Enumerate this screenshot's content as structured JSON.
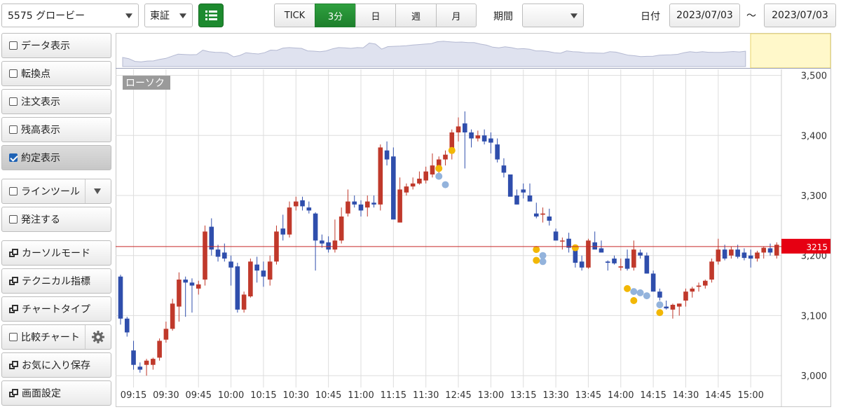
{
  "toolbar": {
    "stock_select": "5575 グロービー",
    "market_select": "東証",
    "intervals": [
      "TICK",
      "3分",
      "日",
      "週",
      "月"
    ],
    "active_interval": "3分",
    "period_label": "期間",
    "period_value": "",
    "date_label": "日付",
    "date_from": "2023/07/03",
    "date_sep": "～",
    "date_to": "2023/07/03"
  },
  "sidebar": {
    "data_display": "データ表示",
    "turning_point": "転換点",
    "order_display": "注文表示",
    "position_display": "残高表示",
    "execution_display": "約定表示",
    "line_tool": "ラインツール",
    "place_order": "発注する",
    "cursor_mode": "カーソルモード",
    "technical": "テクニカル指標",
    "chart_type": "チャートタイプ",
    "compare_chart": "比較チャート",
    "save_favorite": "お気に入り保存",
    "screen_settings": "画面設定"
  },
  "colors": {
    "up": "#c0392b",
    "down": "#2f4eac",
    "buy_marker": "#f2b705",
    "sell_marker": "#93b3dc",
    "price_line": "#c62828",
    "price_badge": "#e60012",
    "active": "#1d8a2f"
  },
  "chart_data": {
    "type": "candlestick",
    "chart_label": "ローソク",
    "current_price": "3215",
    "current_price_value": 3215,
    "ylim": [
      2985,
      3510
    ],
    "y_ticks": [
      3000,
      3100,
      3200,
      3300,
      3400,
      3500
    ],
    "y_tick_labels": [
      "3,000",
      "3,100",
      "3,200",
      "3,300",
      "3,400",
      "3,500"
    ],
    "x_tick_labels": [
      "09:15",
      "09:30",
      "09:45",
      "10:00",
      "10:15",
      "10:30",
      "10:45",
      "11:00",
      "11:15",
      "11:30",
      "12:45",
      "13:00",
      "13:15",
      "13:30",
      "13:45",
      "14:00",
      "14:15",
      "14:30",
      "14:45",
      "15:00"
    ],
    "x_tick_index": [
      2,
      7,
      12,
      17,
      22,
      27,
      32,
      37,
      42,
      47,
      52,
      57,
      62,
      67,
      72,
      77,
      82,
      87,
      92,
      97
    ],
    "candles": [
      [
        3165,
        3168,
        3085,
        3095
      ],
      [
        3095,
        3098,
        3065,
        3072
      ],
      [
        3042,
        3058,
        3010,
        3018
      ],
      [
        3015,
        3022,
        3005,
        3010
      ],
      [
        3018,
        3028,
        3000,
        3025
      ],
      [
        3018,
        3030,
        3010,
        3028
      ],
      [
        3030,
        3062,
        3025,
        3058
      ],
      [
        3060,
        3090,
        3055,
        3078
      ],
      [
        3078,
        3128,
        3075,
        3120
      ],
      [
        3115,
        3172,
        3090,
        3160
      ],
      [
        3160,
        3165,
        3098,
        3155
      ],
      [
        3155,
        3162,
        3105,
        3150
      ],
      [
        3145,
        3158,
        3135,
        3152
      ],
      [
        3160,
        3250,
        3150,
        3240
      ],
      [
        3248,
        3262,
        3200,
        3210
      ],
      [
        3210,
        3218,
        3190,
        3198
      ],
      [
        3205,
        3220,
        3190,
        3195
      ],
      [
        3190,
        3200,
        3150,
        3180
      ],
      [
        3182,
        3188,
        3105,
        3110
      ],
      [
        3110,
        3140,
        3105,
        3135
      ],
      [
        3132,
        3195,
        3130,
        3190
      ],
      [
        3185,
        3198,
        3155,
        3175
      ],
      [
        3175,
        3190,
        3148,
        3165
      ],
      [
        3160,
        3200,
        3150,
        3190
      ],
      [
        3190,
        3250,
        3185,
        3240
      ],
      [
        3245,
        3268,
        3225,
        3235
      ],
      [
        3235,
        3290,
        3230,
        3280
      ],
      [
        3282,
        3298,
        3275,
        3290
      ],
      [
        3292,
        3298,
        3275,
        3282
      ],
      [
        3280,
        3290,
        3270,
        3275
      ],
      [
        3270,
        3272,
        3175,
        3225
      ],
      [
        3225,
        3235,
        3213,
        3220
      ],
      [
        3222,
        3232,
        3205,
        3210
      ],
      [
        3210,
        3260,
        3205,
        3225
      ],
      [
        3225,
        3280,
        3220,
        3265
      ],
      [
        3270,
        3310,
        3265,
        3290
      ],
      [
        3290,
        3300,
        3280,
        3285
      ],
      [
        3285,
        3292,
        3265,
        3275
      ],
      [
        3280,
        3300,
        3265,
        3290
      ],
      [
        3288,
        3300,
        3280,
        3285
      ],
      [
        3285,
        3385,
        3275,
        3380
      ],
      [
        3375,
        3390,
        3350,
        3360
      ],
      [
        3365,
        3380,
        3275,
        3260
      ],
      [
        3255,
        3330,
        3255,
        3310
      ],
      [
        3305,
        3320,
        3300,
        3315
      ],
      [
        3315,
        3330,
        3310,
        3320
      ],
      [
        3320,
        3340,
        3318,
        3328
      ],
      [
        3325,
        3348,
        3320,
        3340
      ],
      [
        3335,
        3370,
        3330,
        3350
      ],
      [
        3345,
        3365,
        3335,
        3360
      ],
      [
        3360,
        3375,
        3350,
        3368
      ],
      [
        3370,
        3410,
        3360,
        3405
      ],
      [
        3405,
        3430,
        3390,
        3415
      ],
      [
        3420,
        3440,
        3345,
        3405
      ],
      [
        3405,
        3410,
        3380,
        3395
      ],
      [
        3395,
        3408,
        3390,
        3400
      ],
      [
        3400,
        3410,
        3385,
        3390
      ],
      [
        3395,
        3405,
        3370,
        3388
      ],
      [
        3385,
        3395,
        3355,
        3360
      ],
      [
        3350,
        3362,
        3330,
        3338
      ],
      [
        3335,
        3335,
        3300,
        3298
      ],
      [
        3300,
        3310,
        3285,
        3285
      ],
      [
        3310,
        3320,
        3295,
        3305
      ],
      [
        3300,
        3320,
        3290,
        3290
      ],
      [
        3270,
        3288,
        3262,
        3265
      ],
      [
        3268,
        3280,
        3255,
        3270
      ],
      [
        3265,
        3278,
        3250,
        3258
      ],
      [
        3240,
        3245,
        3225,
        3225
      ],
      [
        3225,
        3230,
        3210,
        3225
      ],
      [
        3228,
        3238,
        3205,
        3213
      ],
      [
        3210,
        3215,
        3180,
        3188
      ],
      [
        3190,
        3200,
        3175,
        3180
      ],
      [
        3180,
        3228,
        3178,
        3225
      ],
      [
        3222,
        3240,
        3215,
        3210
      ],
      [
        3212,
        3225,
        3205,
        3205
      ],
      [
        3190,
        3192,
        3175,
        3188
      ],
      [
        3195,
        3200,
        3185,
        3187
      ],
      [
        3180,
        3195,
        3175,
        3182
      ],
      [
        3195,
        3210,
        3175,
        3178
      ],
      [
        3180,
        3225,
        3175,
        3210
      ],
      [
        3205,
        3210,
        3195,
        3200
      ],
      [
        3200,
        3205,
        3170,
        3170
      ],
      [
        3170,
        3175,
        3140,
        3140
      ],
      [
        3140,
        3145,
        3125,
        3130
      ],
      [
        3115,
        3125,
        3110,
        3112
      ],
      [
        3110,
        3120,
        3095,
        3118
      ],
      [
        3115,
        3120,
        3100,
        3120
      ],
      [
        3125,
        3145,
        3115,
        3140
      ],
      [
        3140,
        3148,
        3130,
        3145
      ],
      [
        3148,
        3155,
        3140,
        3150
      ],
      [
        3150,
        3160,
        3145,
        3158
      ],
      [
        3160,
        3195,
        3155,
        3190
      ],
      [
        3190,
        3228,
        3185,
        3210
      ],
      [
        3210,
        3218,
        3192,
        3195
      ],
      [
        3200,
        3215,
        3195,
        3210
      ],
      [
        3210,
        3218,
        3195,
        3198
      ],
      [
        3205,
        3212,
        3192,
        3196
      ],
      [
        3200,
        3210,
        3180,
        3195
      ],
      [
        3195,
        3208,
        3190,
        3205
      ],
      [
        3205,
        3215,
        3195,
        3213
      ],
      [
        3212,
        3220,
        3200,
        3205
      ],
      [
        3200,
        3222,
        3195,
        3218
      ]
    ],
    "buy_markers": [
      [
        49,
        3345
      ],
      [
        51,
        3375
      ],
      [
        64,
        3210
      ],
      [
        64,
        3192
      ],
      [
        70,
        3213
      ],
      [
        78,
        3145
      ],
      [
        79,
        3125
      ],
      [
        83,
        3105
      ]
    ],
    "sell_markers": [
      [
        49,
        3332
      ],
      [
        50,
        3318
      ],
      [
        65,
        3200
      ],
      [
        65,
        3190
      ],
      [
        79,
        3140
      ],
      [
        80,
        3138
      ],
      [
        81,
        3133
      ],
      [
        83,
        3118
      ]
    ]
  }
}
